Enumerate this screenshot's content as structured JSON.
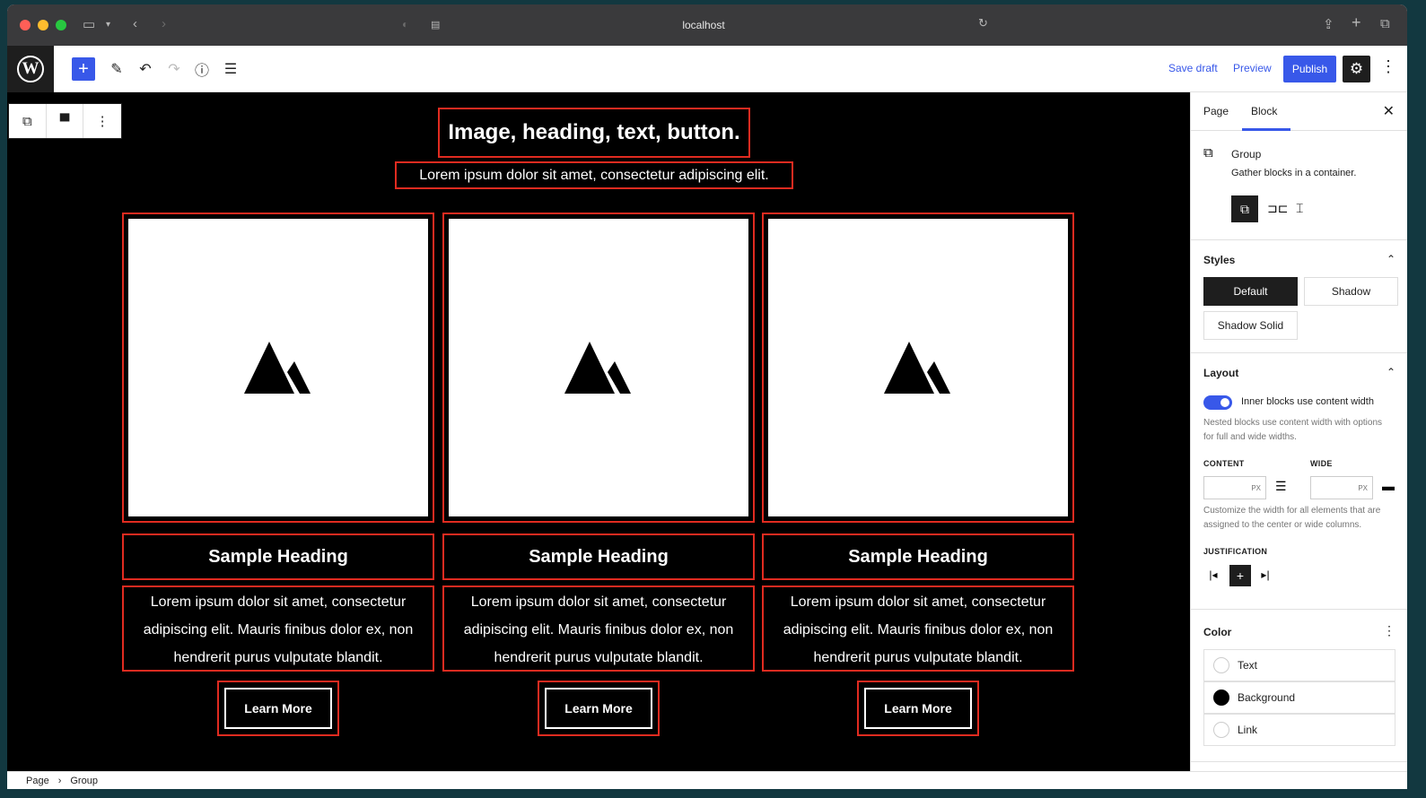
{
  "browser": {
    "url": "localhost",
    "colors": {
      "red": "#ff5f57",
      "yellow": "#febc2e",
      "green": "#28c840"
    }
  },
  "toolbar": {
    "save_draft": "Save draft",
    "preview": "Preview",
    "publish": "Publish"
  },
  "canvas": {
    "heading": "Image, heading, text, button.",
    "subheading": "Lorem ipsum dolor sit amet, consectetur adipiscing elit.",
    "columns": [
      {
        "heading": "Sample Heading",
        "text": "Lorem ipsum dolor sit amet, consectetur adipiscing elit. Mauris finibus dolor ex, non hendrerit purus vulputate blandit.",
        "button": "Learn More"
      },
      {
        "heading": "Sample Heading",
        "text": "Lorem ipsum dolor sit amet, consectetur adipiscing elit. Mauris finibus dolor ex, non hendrerit purus vulputate blandit.",
        "button": "Learn More"
      },
      {
        "heading": "Sample Heading",
        "text": "Lorem ipsum dolor sit amet, consectetur adipiscing elit. Mauris finibus dolor ex, non hendrerit purus vulputate blandit.",
        "button": "Learn More"
      }
    ],
    "outline_color": "#e02b20"
  },
  "sidebar": {
    "tabs": [
      "Page",
      "Block"
    ],
    "active_tab": "Block",
    "block": {
      "name": "Group",
      "description": "Gather blocks in a container."
    },
    "styles": {
      "title": "Styles",
      "options": [
        "Default",
        "Shadow",
        "Shadow Solid"
      ],
      "selected": "Default"
    },
    "layout": {
      "title": "Layout",
      "toggle_label": "Inner blocks use content width",
      "toggle_on": true,
      "toggle_help": "Nested blocks use content width with options for full and wide widths.",
      "content_label": "CONTENT",
      "wide_label": "WIDE",
      "unit": "PX",
      "width_help": "Customize the width for all elements that are assigned to the center or wide columns.",
      "justification_label": "JUSTIFICATION"
    },
    "color": {
      "title": "Color",
      "items": [
        {
          "label": "Text",
          "swatch": "#ffffff"
        },
        {
          "label": "Background",
          "swatch": "#000000"
        },
        {
          "label": "Link",
          "swatch": "#ffffff"
        }
      ]
    }
  },
  "breadcrumb": {
    "items": [
      "Page",
      "Group"
    ],
    "separator": "›"
  },
  "accent": "#3858e9"
}
